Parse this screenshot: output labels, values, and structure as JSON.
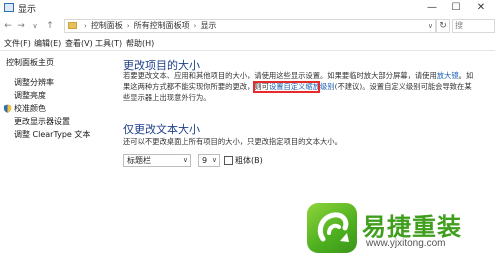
{
  "window": {
    "title": "显示",
    "minimize": "—",
    "maximize": "☐",
    "close": "✕"
  },
  "address_bar": {
    "back": "←",
    "forward": "→",
    "dropdown": "∨",
    "up": "↑",
    "breadcrumb": [
      "控制面板",
      "所有控制面板项",
      "显示"
    ],
    "refresh": "↻",
    "search_placeholder": "搜"
  },
  "menu": [
    "文件(F)",
    "编辑(E)",
    "查看(V)",
    "工具(T)",
    "帮助(H)"
  ],
  "sidebar": {
    "home": "控制面板主页",
    "items": [
      "调整分辨率",
      "调整亮度",
      "校准颜色",
      "更改显示器设置",
      "调整 ClearType 文本"
    ]
  },
  "main": {
    "heading1": "更改项目的大小",
    "para1": [
      {
        "text": "若要更改文本、应用和其他项目的大小，请使用这些显示设置。如果要临时放大部分屏幕，请使用"
      },
      {
        "text": "放大镜",
        "link": true
      },
      {
        "text": "。如"
      },
      {
        "text": "果这两种方式都不能实现你所要的更改，则可"
      },
      {
        "text": "设置自定义缩放级别",
        "link": true
      },
      {
        "text": "(不建议)。设置自定义级别可能会导致在某"
      },
      {
        "text": "些显示器上出现意外行为。"
      }
    ],
    "heading2": "仅更改文本大小",
    "para2": "还可以不更改桌面上所有项目的大小，只更改指定项目的文本大小。",
    "item_select": "标题栏",
    "size_select": "9",
    "bold_label": "粗体(B)",
    "select_arrow": "∨"
  },
  "watermark": {
    "title": "易捷重装",
    "url": "www.yjxitong.com"
  },
  "colors": {
    "heading": "#1e3f8a",
    "link": "#1a5fb4",
    "highlight": "#e52b2b",
    "watermark_green": "#3f9f1c"
  }
}
